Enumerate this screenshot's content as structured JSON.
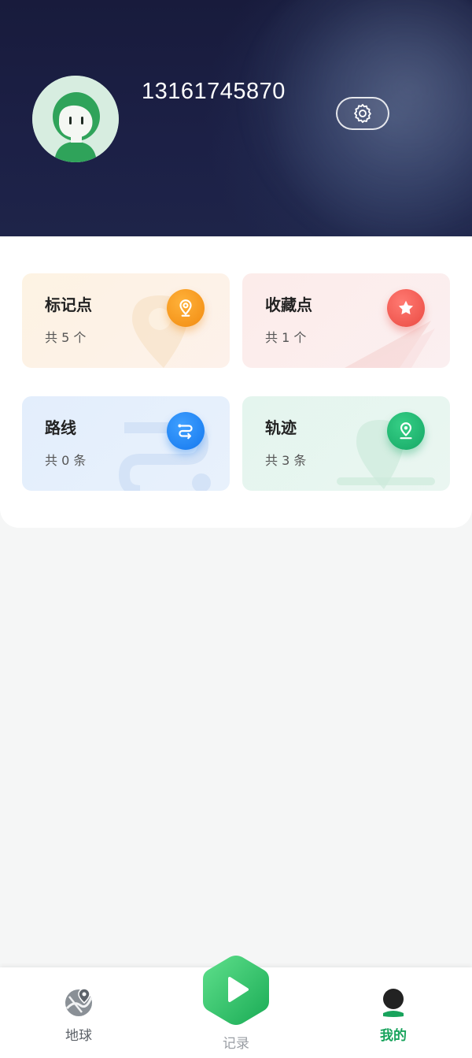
{
  "profile": {
    "phone": "13161745870"
  },
  "tiles": [
    {
      "title": "标记点",
      "count": "共 5 个",
      "icon": "location-pin-icon"
    },
    {
      "title": "收藏点",
      "count": "共 1 个",
      "icon": "star-icon"
    },
    {
      "title": "路线",
      "count": "共 0 条",
      "icon": "route-icon"
    },
    {
      "title": "轨迹",
      "count": "共 3 条",
      "icon": "track-pin-icon"
    }
  ],
  "nav": {
    "earth_label": "地球",
    "record_label": "记录",
    "mine_label": "我的"
  },
  "colors": {
    "header_bg": "#1c2046",
    "active_nav": "#18a35c",
    "orange": "#f18a10",
    "red": "#ea4a42",
    "blue": "#1477ee",
    "green": "#15a765"
  }
}
